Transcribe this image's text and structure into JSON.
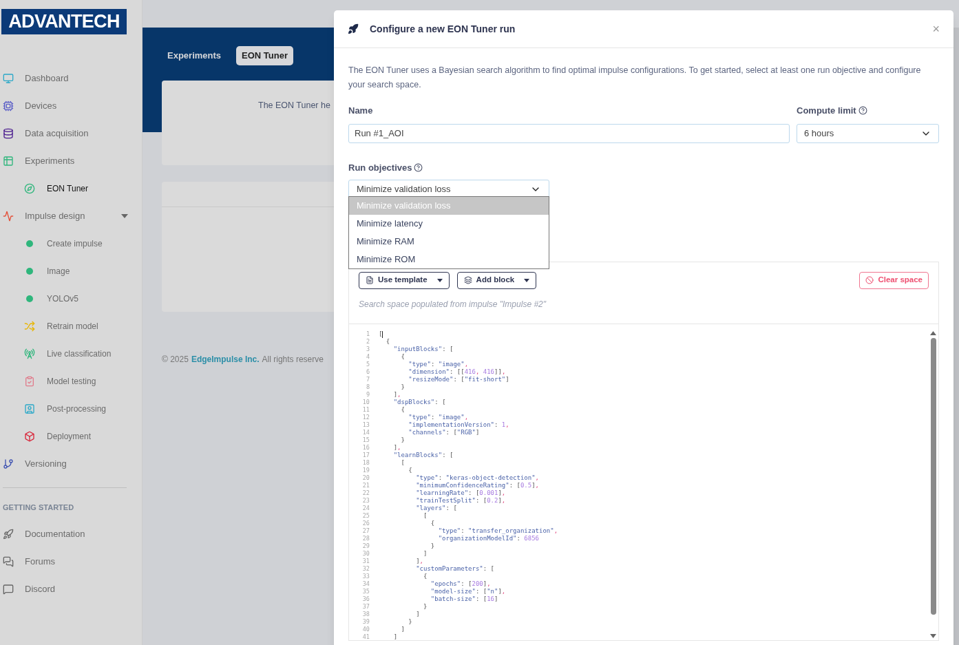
{
  "logo": "ADVANTECH",
  "sidebar": {
    "items": [
      {
        "label": "Dashboard",
        "selected": false
      },
      {
        "label": "Devices",
        "selected": false
      },
      {
        "label": "Data acquisition",
        "selected": false
      },
      {
        "label": "Experiments",
        "selected": false,
        "children": [
          {
            "label": "EON Tuner",
            "selected": true
          }
        ]
      },
      {
        "label": "Impulse design",
        "selected": false,
        "expanded": true,
        "children": [
          {
            "label": "Create impulse",
            "selected": false
          },
          {
            "label": "Image",
            "selected": false
          },
          {
            "label": "YOLOv5",
            "selected": false
          },
          {
            "label": "Retrain model",
            "selected": false
          },
          {
            "label": "Live classification",
            "selected": false
          },
          {
            "label": "Model testing",
            "selected": false
          },
          {
            "label": "Post-processing",
            "selected": false
          },
          {
            "label": "Deployment",
            "selected": false
          }
        ]
      },
      {
        "label": "Versioning",
        "selected": false
      }
    ],
    "section_title": "GETTING STARTED",
    "links": [
      {
        "label": "Documentation"
      },
      {
        "label": "Forums"
      },
      {
        "label": "Discord"
      }
    ]
  },
  "page_tabs": [
    {
      "label": "Experiments",
      "selected": false
    },
    {
      "label": "EON Tuner",
      "selected": true
    }
  ],
  "intro_card": {
    "text": "The EON Tuner he"
  },
  "footer": {
    "copyright": "© 2025",
    "company": "EdgeImpulse Inc.",
    "rights": "All rights reserve"
  },
  "modal": {
    "title": "Configure a new EON Tuner run",
    "close": "×",
    "description": "The EON Tuner uses a Bayesian search algorithm to find optimal impulse configurations. To get started, select at least one run objective and configure your search space.",
    "name_field": {
      "label": "Name",
      "value": "Run #1_AOI"
    },
    "compute_limit": {
      "label": "Compute limit",
      "value": "6 hours"
    },
    "run_objectives": {
      "label": "Run objectives",
      "value": "Minimize validation loss",
      "expanded": true,
      "options": [
        {
          "label": "Minimize validation loss",
          "selected": true
        },
        {
          "label": "Minimize latency",
          "selected": false
        },
        {
          "label": "Minimize RAM",
          "selected": false
        },
        {
          "label": "Minimize ROM",
          "selected": false
        }
      ]
    },
    "search_space": {
      "buttons": [
        "Use template",
        "Add block"
      ],
      "clear_button": "Clear space",
      "hint": "Search space populated from impulse \"Impulse #2\"",
      "code_lines": [
        {
          "n": "1",
          "text": "["
        },
        {
          "n": "2",
          "text": "  {"
        },
        {
          "n": "3",
          "text": "    \"inputBlocks\": ["
        },
        {
          "n": "4",
          "text": "      {"
        },
        {
          "n": "5",
          "text": "        \"type\": \"image\","
        },
        {
          "n": "6",
          "text": "        \"dimension\": [[416, 416]],"
        },
        {
          "n": "7",
          "text": "        \"resizeMode\": [\"fit-short\"]"
        },
        {
          "n": "8",
          "text": "      }"
        },
        {
          "n": "9",
          "text": "    ],"
        },
        {
          "n": "10",
          "text": "    \"dspBlocks\": ["
        },
        {
          "n": "11",
          "text": "      {"
        },
        {
          "n": "12",
          "text": "        \"type\": \"image\","
        },
        {
          "n": "13",
          "text": "        \"implementationVersion\": 1,"
        },
        {
          "n": "14",
          "text": "        \"channels\": [\"RGB\"]"
        },
        {
          "n": "15",
          "text": "      }"
        },
        {
          "n": "16",
          "text": "    ],"
        },
        {
          "n": "17",
          "text": "    \"learnBlocks\": ["
        },
        {
          "n": "18",
          "text": "      ["
        },
        {
          "n": "19",
          "text": "        {"
        },
        {
          "n": "20",
          "text": "          \"type\": \"keras-object-detection\","
        },
        {
          "n": "21",
          "text": "          \"minimumConfidenceRating\": [0.5],"
        },
        {
          "n": "22",
          "text": "          \"learningRate\": [0.001],"
        },
        {
          "n": "23",
          "text": "          \"trainTestSplit\": [0.2],"
        },
        {
          "n": "24",
          "text": "          \"layers\": ["
        },
        {
          "n": "25",
          "text": "            ["
        },
        {
          "n": "26",
          "text": "              {"
        },
        {
          "n": "27",
          "text": "                \"type\": \"transfer_organization\","
        },
        {
          "n": "28",
          "text": "                \"organizationModelId\": 6856"
        },
        {
          "n": "29",
          "text": "              }"
        },
        {
          "n": "30",
          "text": "            ]"
        },
        {
          "n": "31",
          "text": "          ],"
        },
        {
          "n": "32",
          "text": "          \"customParameters\": ["
        },
        {
          "n": "33",
          "text": "            {"
        },
        {
          "n": "34",
          "text": "              \"epochs\": [200],"
        },
        {
          "n": "35",
          "text": "              \"model-size\": [\"n\"],"
        },
        {
          "n": "36",
          "text": "              \"batch-size\": [16]"
        },
        {
          "n": "37",
          "text": "            }"
        },
        {
          "n": "38",
          "text": "          ]"
        },
        {
          "n": "39",
          "text": "        }"
        },
        {
          "n": "40",
          "text": "      ]"
        },
        {
          "n": "41",
          "text": "    ]"
        }
      ]
    }
  }
}
